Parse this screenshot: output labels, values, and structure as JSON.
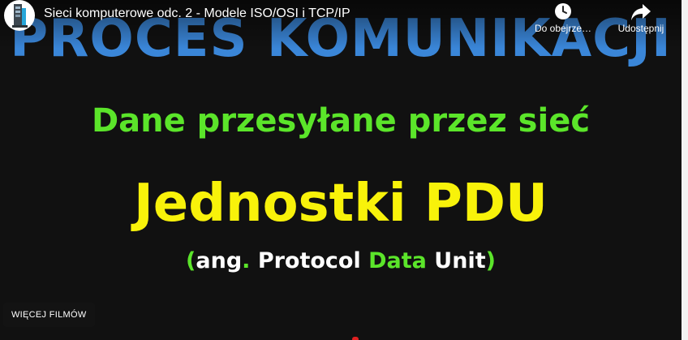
{
  "player": {
    "video_title": "Sieci komputerowe odc. 2 - Modele ISO/OSI i TCP/IP",
    "watch_later_label": "Do obejrze…",
    "share_label": "Udostępnij",
    "more_videos_label": "WIĘCEJ FILMÓW",
    "icons": {
      "avatar": "channel-logo-icon",
      "watch_later": "clock-icon",
      "share": "share-arrow-icon"
    }
  },
  "slide": {
    "title": "PROCES KOMUNIKACJI",
    "subtitle": "Dane przesyłane przez sieć",
    "heading": "Jednostki PDU",
    "expansion": {
      "open_paren": "(",
      "ang": "ang",
      "dot": ".",
      "protocol": " Protocol ",
      "data": "Data",
      "unit": " Unit",
      "close_paren": ")"
    }
  },
  "colors": {
    "title": "#3a86d8",
    "green": "#5be52a",
    "yellow": "#f8f20a",
    "background": "#111111"
  }
}
